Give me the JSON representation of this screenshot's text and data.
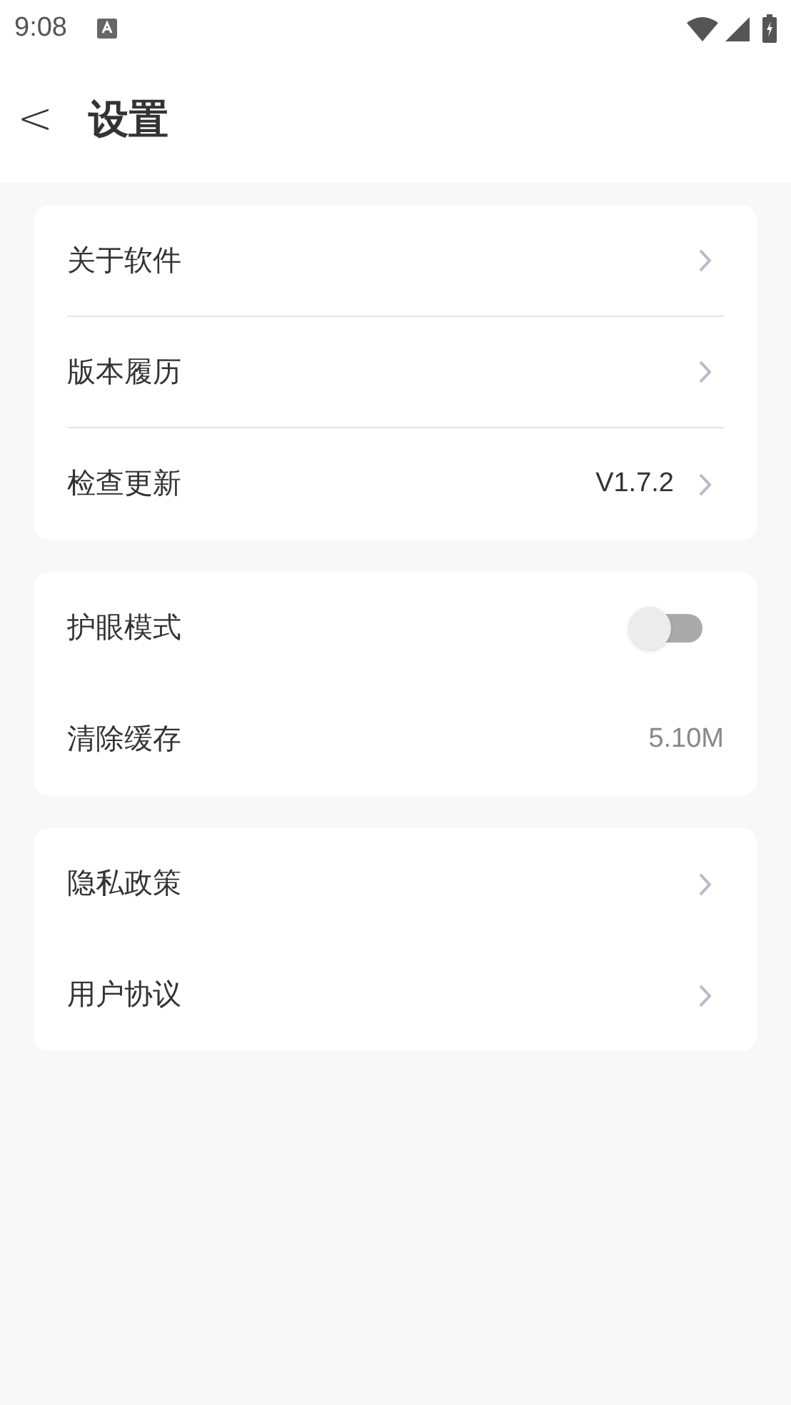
{
  "status_bar": {
    "time": "9:08"
  },
  "header": {
    "title": "设置",
    "back_icon": "<"
  },
  "groups": [
    {
      "dividers": true,
      "rows": [
        {
          "kind": "link",
          "label": "关于软件"
        },
        {
          "kind": "link",
          "label": "版本履历"
        },
        {
          "kind": "link",
          "label": "检查更新",
          "value": "V1.7.2"
        }
      ]
    },
    {
      "dividers": false,
      "rows": [
        {
          "kind": "toggle",
          "label": "护眼模式",
          "on": false
        },
        {
          "kind": "value",
          "label": "清除缓存",
          "value": "5.10M"
        }
      ]
    },
    {
      "dividers": false,
      "rows": [
        {
          "kind": "link",
          "label": "隐私政策"
        },
        {
          "kind": "link",
          "label": "用户协议"
        }
      ]
    }
  ]
}
